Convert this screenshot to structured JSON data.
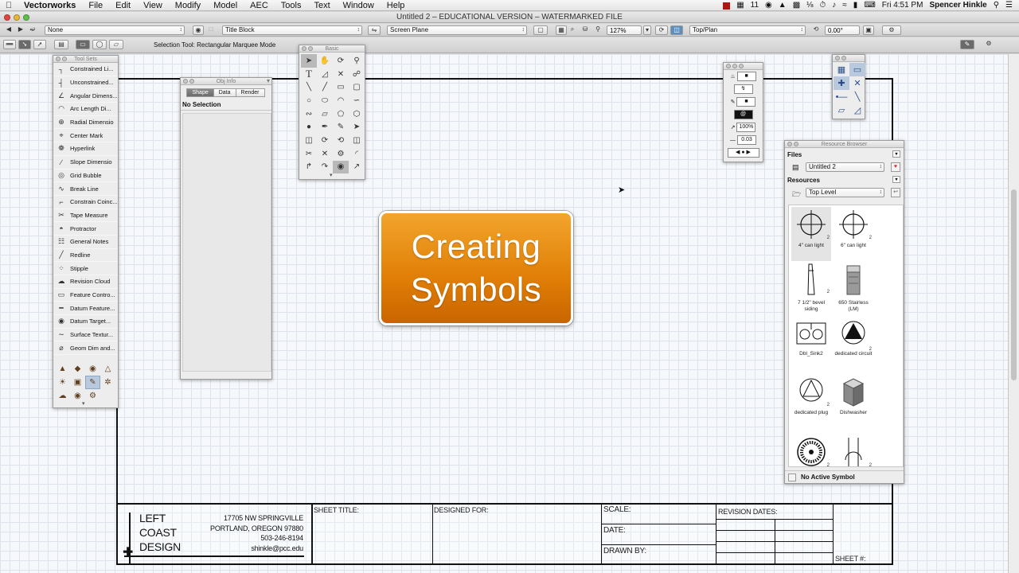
{
  "menubar": {
    "app_name": "Vectorworks",
    "items": [
      "File",
      "Edit",
      "View",
      "Modify",
      "Model",
      "AEC",
      "Tools",
      "Text",
      "Window",
      "Help"
    ],
    "status_badge": "11",
    "clock": "Fri 4:51 PM",
    "user_name": "Spencer Hinkle"
  },
  "window": {
    "title": "Untitled 2 – EDUCATIONAL VERSION – WATERMARKED FILE"
  },
  "toolbar": {
    "class_select": "None",
    "layer_select": "Title Block",
    "plane_select": "Screen Plane",
    "zoom_value": "127%",
    "view_select": "Top/Plan",
    "rotation_value": "0.00°",
    "tool_mode": "Selection Tool: Rectangular Marquee Mode"
  },
  "tool_sets": {
    "title": "Tool Sets",
    "items": [
      {
        "label": "Constrained Li...",
        "icon": "constrained-linear-icon"
      },
      {
        "label": "Unconstrained...",
        "icon": "unconstrained-icon"
      },
      {
        "label": "Angular Dimens...",
        "icon": "angular-dimension-icon"
      },
      {
        "label": "Arc Length Di...",
        "icon": "arc-length-icon"
      },
      {
        "label": "Radial Dimensio",
        "icon": "radial-dimension-icon"
      },
      {
        "label": "Center Mark",
        "icon": "center-mark-icon"
      },
      {
        "label": "Hyperlink",
        "icon": "hyperlink-icon"
      },
      {
        "label": "Slope Dimensio",
        "icon": "slope-dimension-icon"
      },
      {
        "label": "Grid Bubble",
        "icon": "grid-bubble-icon"
      },
      {
        "label": "Break Line",
        "icon": "break-line-icon"
      },
      {
        "label": "Constrain Coinc...",
        "icon": "constrain-coincident-icon"
      },
      {
        "label": "Tape Measure",
        "icon": "tape-measure-icon"
      },
      {
        "label": "Protractor",
        "icon": "protractor-icon"
      },
      {
        "label": "General Notes",
        "icon": "general-notes-icon"
      },
      {
        "label": "Redline",
        "icon": "redline-icon"
      },
      {
        "label": "Stipple",
        "icon": "stipple-icon"
      },
      {
        "label": "Revision Cloud",
        "icon": "revision-cloud-icon"
      },
      {
        "label": "Feature Contro...",
        "icon": "feature-control-icon"
      },
      {
        "label": "Datum Feature...",
        "icon": "datum-feature-icon"
      },
      {
        "label": "Datum Target...",
        "icon": "datum-target-icon"
      },
      {
        "label": "Surface Textur...",
        "icon": "surface-texture-icon"
      },
      {
        "label": "Geom Dim and...",
        "icon": "geom-dim-icon"
      }
    ]
  },
  "obj_info": {
    "title": "Obj Info",
    "tabs": [
      "Shape",
      "Data",
      "Render"
    ],
    "active_tab": "Shape",
    "selection": "No Selection"
  },
  "basic_palette": {
    "title": "Basic"
  },
  "attributes": {
    "opacity": "100%",
    "line_weight": "0.03"
  },
  "resource_browser": {
    "title": "Resource Browser",
    "files_label": "Files",
    "file_select": "Untitled 2",
    "resources_label": "Resources",
    "folder_select": "Top Level",
    "items": [
      "4\" can light",
      "6\" can light",
      "7 1/2\" bevel siding",
      "650 Stairless (LM)",
      "Dbl_Sink2",
      "dedicated circuit",
      "dedicated plug",
      "Dishwasher"
    ],
    "status": "No Active Symbol"
  },
  "overlay": {
    "text": "Creating\nSymbols",
    "colors": {
      "top": "#f2a52c",
      "bottom": "#c96500"
    }
  },
  "title_block": {
    "company_lines": [
      "LEFT",
      "COAST",
      "DESIGN"
    ],
    "address_lines": [
      "17705 NW SPRINGVILLE",
      "PORTLAND, OREGON 97880",
      "503-246-8194",
      "shinkle@pcc.edu"
    ],
    "sheet_title_label": "SHEET TITLE:",
    "designed_for_label": "DESIGNED FOR:",
    "scale_label": "SCALE:",
    "date_label": "DATE:",
    "drawn_by_label": "DRAWN BY:",
    "revision_dates_label": "REVISION DATES:",
    "sheet_number_label": "SHEET #:"
  }
}
